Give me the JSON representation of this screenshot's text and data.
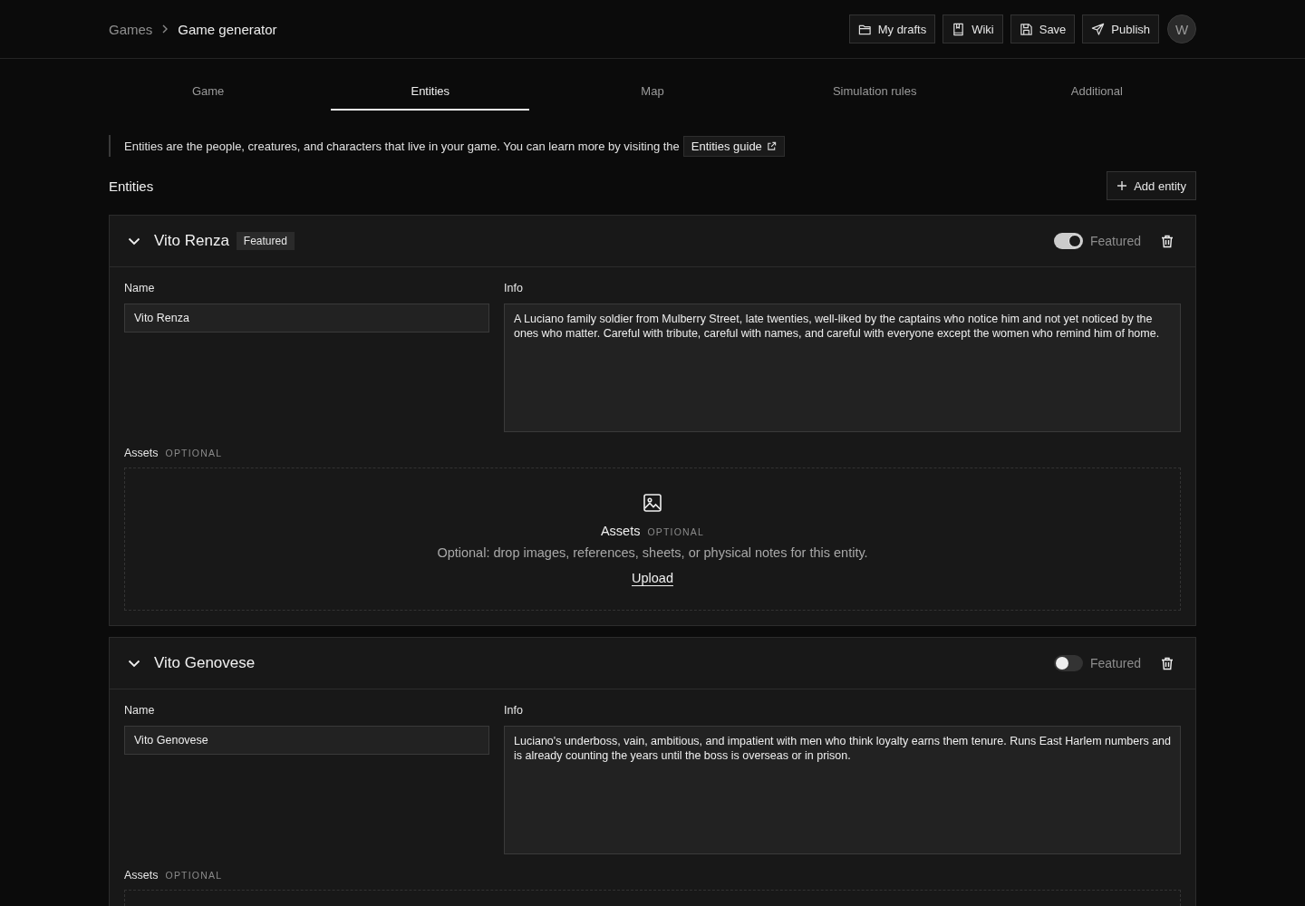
{
  "breadcrumb": [
    {
      "label": "Games",
      "current": false
    },
    {
      "label": "Game generator",
      "current": true
    }
  ],
  "header_actions": [
    {
      "kind": "folder",
      "label": "My drafts"
    },
    {
      "kind": "book",
      "label": "Wiki"
    },
    {
      "kind": "save",
      "label": "Save"
    },
    {
      "kind": "send",
      "label": "Publish"
    }
  ],
  "avatar": "W",
  "tabs": [
    {
      "label": "Game",
      "selected": false
    },
    {
      "label": "Entities",
      "selected": true
    },
    {
      "label": "Map",
      "selected": false
    },
    {
      "label": "Simulation rules",
      "selected": false
    },
    {
      "label": "Additional",
      "selected": false
    }
  ],
  "intro": {
    "text": "Entities are the people, creatures, and characters that live in your game. You can learn more by visiting the",
    "link": "Entities guide"
  },
  "section": {
    "title": "Entities",
    "add_button": "Add entity"
  },
  "entities": [
    {
      "title": "Vito Renza",
      "badge": "Featured",
      "featured": true,
      "toggle_label": "Featured",
      "expanded": true,
      "name_label": "Name",
      "name": "Vito Renza",
      "info_label": "Info",
      "info": "A Luciano family soldier from Mulberry Street, late twenties, well-liked by the captains who notice him and not yet noticed by the ones who matter. Careful with tribute, careful with names, and careful with everyone except the women who remind him of home.",
      "assets_label": "Assets",
      "assets_tag": "OPTIONAL",
      "dropzone": {
        "title": "Assets",
        "tag": "OPTIONAL",
        "hint": "Optional: drop images, references, sheets, or physical notes for this entity.",
        "action": "Upload"
      }
    },
    {
      "title": "Vito Genovese",
      "featured": false,
      "toggle_label": "Featured",
      "expanded": true,
      "name_label": "Name",
      "name": "Vito Genovese",
      "info_label": "Info",
      "info": "Luciano's underboss, vain, ambitious, and impatient with men who think loyalty earns them tenure. Runs East Harlem numbers and is already counting the years until the boss is overseas or in prison.",
      "assets_label": "Assets",
      "assets_tag": "OPTIONAL"
    }
  ]
}
